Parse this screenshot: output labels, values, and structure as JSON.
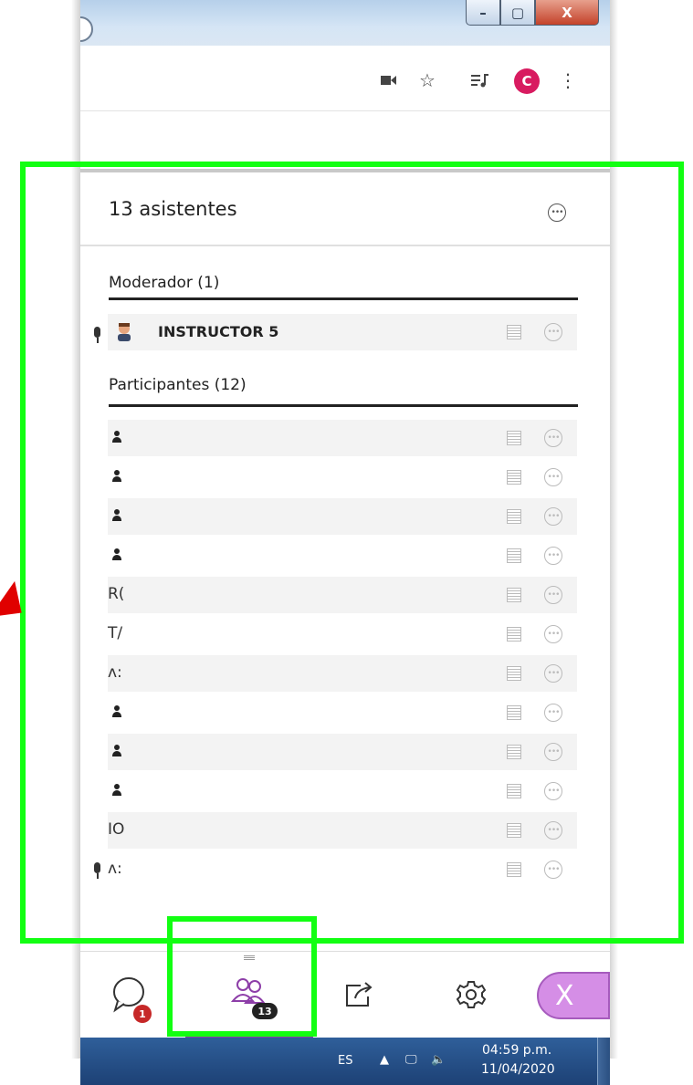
{
  "window": {
    "minimize": "–",
    "maximize": "▢",
    "close": "X"
  },
  "browser_toolbar": {
    "camera_icon": "video-camera-icon",
    "star_icon": "star-icon",
    "playlist_icon": "media-playlist-icon",
    "profile_initial": "C",
    "menu_icon": "kebab-menu-icon"
  },
  "panel": {
    "title": "13 asistentes",
    "moderator_section": "Moderador (1)",
    "moderator": {
      "name": "INSTRUCTOR 5"
    },
    "participants_section": "Participantes (12)",
    "participants": [
      {
        "initials": ""
      },
      {
        "initials": ""
      },
      {
        "initials": ""
      },
      {
        "initials": ""
      },
      {
        "initials": "R("
      },
      {
        "initials": "T/"
      },
      {
        "initials": "ʌ:"
      },
      {
        "initials": ""
      },
      {
        "initials": ""
      },
      {
        "initials": ""
      },
      {
        "initials": "IO"
      },
      {
        "initials": "ʌ:"
      }
    ]
  },
  "bottom_bar": {
    "chat_badge": "1",
    "attendees_badge": "13",
    "leave_label": "X"
  },
  "taskbar": {
    "language": "ES",
    "time": "04:59 p.m.",
    "date": "11/04/2020"
  },
  "colors": {
    "highlight": "#12ff12",
    "accent_purple": "#8d3ea8",
    "arrow": "#e00000"
  }
}
